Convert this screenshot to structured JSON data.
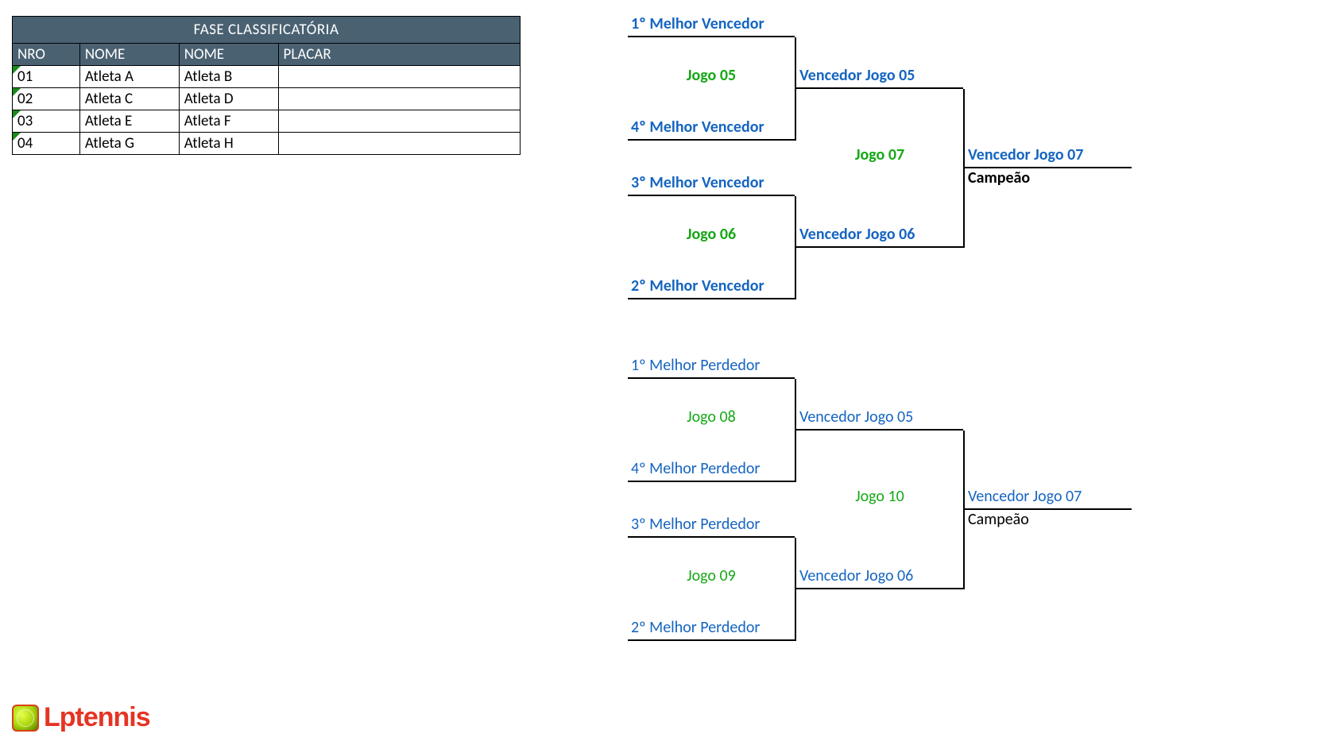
{
  "table": {
    "title": "FASE CLASSIFICATÓRIA",
    "headers": {
      "nro": "NRO",
      "nome1": "NOME",
      "nome2": "NOME",
      "placar": "PLACAR"
    },
    "rows": [
      {
        "nro": "01",
        "nome1": "Atleta A",
        "nome2": "Atleta B",
        "placar": ""
      },
      {
        "nro": "02",
        "nome1": "Atleta C",
        "nome2": "Atleta D",
        "placar": ""
      },
      {
        "nro": "03",
        "nome1": "Atleta E",
        "nome2": "Atleta F",
        "placar": ""
      },
      {
        "nro": "04",
        "nome1": "Atleta G",
        "nome2": "Atleta H",
        "placar": ""
      }
    ]
  },
  "bracket": {
    "winners": {
      "r1": {
        "m1": {
          "p1": "1º Melhor Vencedor",
          "p2": "4º Melhor Vencedor",
          "game": "Jogo 05"
        },
        "m2": {
          "p1": "3º Melhor Vencedor",
          "p2": "2º Melhor Vencedor",
          "game": "Jogo 06"
        }
      },
      "r2": {
        "s1": "Vencedor Jogo 05",
        "s2": "Vencedor Jogo 06",
        "game": "Jogo 07"
      },
      "final": {
        "label": "Vencedor Jogo 07",
        "sub": "Campeão"
      }
    },
    "losers": {
      "r1": {
        "m1": {
          "p1": "1º Melhor Perdedor",
          "p2": "4º Melhor Perdedor",
          "game": "Jogo 08"
        },
        "m2": {
          "p1": "3º Melhor Perdedor",
          "p2": "2º Melhor Perdedor",
          "game": "Jogo 09"
        }
      },
      "r2": {
        "s1": "Vencedor Jogo 05",
        "s2": "Vencedor Jogo 06",
        "game": "Jogo 10"
      },
      "final": {
        "label": "Vencedor Jogo 07",
        "sub": "Campeão"
      }
    }
  },
  "logo": {
    "text": "Lptennis"
  }
}
